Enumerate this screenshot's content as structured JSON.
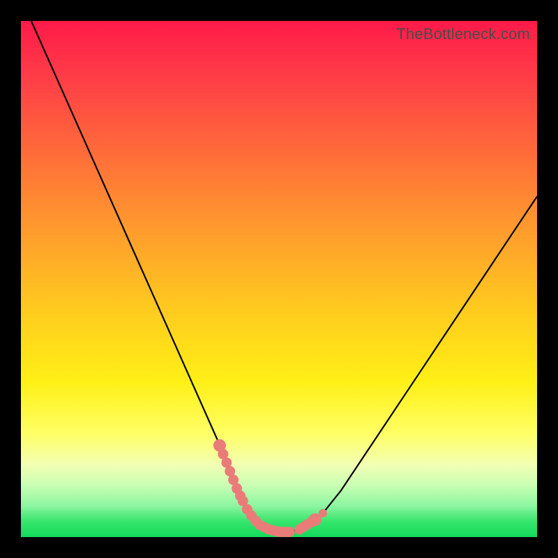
{
  "watermark": "TheBottleneck.com",
  "colors": {
    "curve_stroke": "#000000",
    "salmon": "#e97c79",
    "background_black": "#000000"
  },
  "chart_data": {
    "type": "line",
    "title": "",
    "xlabel": "",
    "ylabel": "",
    "xlim": [
      0,
      100
    ],
    "ylim": [
      0,
      100
    ],
    "grid": false,
    "legend": false,
    "series": [
      {
        "name": "bottleneck-curve",
        "x": [
          2,
          6,
          10,
          14,
          18,
          22,
          26,
          30,
          34,
          38,
          40,
          42,
          44,
          46,
          48,
          50,
          52,
          54,
          58,
          62,
          66,
          70,
          74,
          78,
          82,
          86,
          90,
          94,
          98,
          100
        ],
        "y": [
          100,
          91,
          82,
          73,
          64,
          55,
          46,
          37,
          28,
          19,
          14,
          9,
          5,
          2.5,
          1.5,
          1,
          1,
          1.5,
          4,
          9,
          15,
          21,
          27,
          33,
          39,
          45,
          51,
          57,
          63,
          66
        ]
      }
    ],
    "annotations": [
      {
        "name": "valley-marker-left",
        "type": "dot-line",
        "x_range": [
          38.5,
          42.5
        ],
        "y_approx": [
          13,
          6
        ]
      },
      {
        "name": "valley-marker-bottom",
        "type": "dot-line",
        "x_range": [
          43,
          52
        ],
        "y_approx": [
          2,
          2
        ]
      },
      {
        "name": "valley-marker-right",
        "type": "dot-line",
        "x_range": [
          54,
          57
        ],
        "y_approx": [
          3,
          7
        ]
      }
    ]
  }
}
